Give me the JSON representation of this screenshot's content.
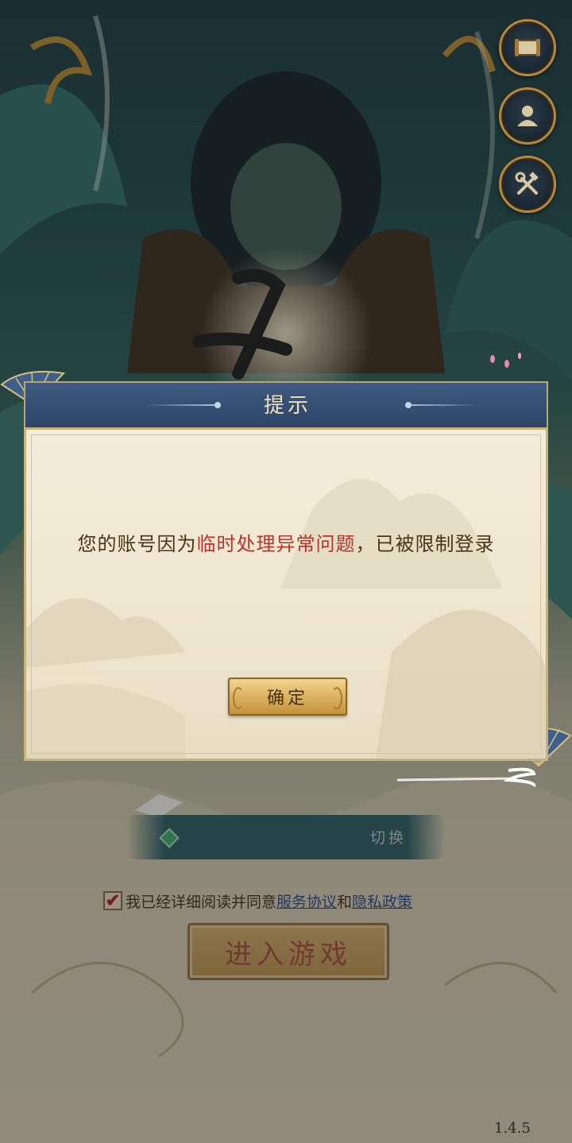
{
  "dialog": {
    "title": "提示",
    "message_before": "您的账号因为",
    "message_highlight": "临时处理异常问题",
    "message_after": "，已被限制登录",
    "confirm_label": "确定"
  },
  "side_buttons": [
    {
      "name": "scroll-icon"
    },
    {
      "name": "user-icon"
    },
    {
      "name": "tools-icon"
    }
  ],
  "login": {
    "switch_label": "切换",
    "agree_prefix": "我已经详细阅读并同意",
    "service_link": "服务协议",
    "and_text": "和",
    "privacy_link": "隐私政策",
    "enter_label": "进入游戏",
    "agreement_checked": true
  },
  "version": "1.4.5",
  "colors": {
    "highlight_red": "#b8332b",
    "header_blue": "#2c4467",
    "gold": "#b4893f"
  }
}
